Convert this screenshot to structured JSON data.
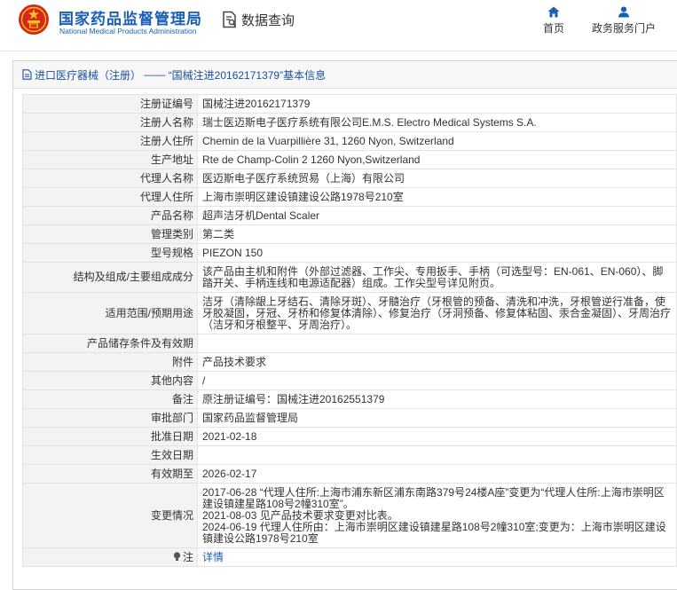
{
  "header": {
    "brand_cn": "国家药品监督管理局",
    "brand_en": "National Medical Products Administration",
    "query_label": "数据查询",
    "nav": [
      {
        "label": "首页",
        "icon": "home-icon"
      },
      {
        "label": "政务服务门户",
        "icon": "user-icon"
      }
    ]
  },
  "panel": {
    "title_prefix": "进口医疗器械（注册）",
    "title_sep": " —— ",
    "title_quote": "“国械注进20162171379”基本信息",
    "icon": "document-icon"
  },
  "rows": [
    {
      "key": "注册证编号",
      "value": "国械注进20162171379"
    },
    {
      "key": "注册人名称",
      "value": "瑞士医迈斯电子医疗系统有限公司E.M.S. Electro Medical Systems S.A."
    },
    {
      "key": "注册人住所",
      "value": "Chemin de la Vuarpillière 31, 1260 Nyon, Switzerland"
    },
    {
      "key": "生产地址",
      "value": "Rte de Champ-Colin 2 1260 Nyon,Switzerland"
    },
    {
      "key": "代理人名称",
      "value": "医迈斯电子医疗系统贸易（上海）有限公司"
    },
    {
      "key": "代理人住所",
      "value": "上海市崇明区建设镇建设公路1978号210室"
    },
    {
      "key": "产品名称",
      "value": "超声洁牙机Dental Scaler"
    },
    {
      "key": "管理类别",
      "value": "第二类"
    },
    {
      "key": "型号规格",
      "value": "PIEZON 150"
    },
    {
      "key": "结构及组成/主要组成成分",
      "value": "该产品由主机和附件（外部过滤器、工作尖、专用扳手、手柄（可选型号：EN-061、EN-060）、脚踏开关、手柄连线和电源适配器）组成。工作尖型号详见附页。"
    },
    {
      "key": "适用范围/预期用途",
      "value": "洁牙（清除龈上牙结石、清除牙斑）、牙髓治疗（牙根管的预备、清洗和冲洗，牙根管逆行准备，使牙胶凝固，牙冠、牙桥和修复体清除）、修复治疗（牙洞预备、修复体粘固、汞合金凝固）、牙周治疗（洁牙和牙根整平、牙周治疗）。"
    },
    {
      "key": "产品储存条件及有效期",
      "value": ""
    },
    {
      "key": "附件",
      "value": "产品技术要求"
    },
    {
      "key": "其他内容",
      "value": "/"
    },
    {
      "key": "备注",
      "value": "原注册证编号：国械注进20162551379"
    },
    {
      "key": "审批部门",
      "value": "国家药品监督管理局"
    },
    {
      "key": "批准日期",
      "value": "2021-02-18"
    },
    {
      "key": "生效日期",
      "value": ""
    },
    {
      "key": "有效期至",
      "value": "2026-02-17"
    },
    {
      "key": "变更情况",
      "value": "2017-06-28 “代理人住所:上海市浦东新区浦东南路379号24楼A座”变更为“代理人住所:上海市崇明区建设镇建星路108号2幢310室”。\n2021-08-03 见产品技术要求变更对比表。\n2024-06-19 代理人住所由：上海市崇明区建设镇建星路108号2幢310室;变更为：上海市崇明区建设镇建设公路1978号210室"
    }
  ],
  "note_row": {
    "key": "注",
    "value": "详情",
    "icon": "info-bulb-icon"
  },
  "colors": {
    "brand_blue": "#1a5fb4",
    "emblem_red": "#d7261e",
    "emblem_gold": "#f5c518",
    "key_bg": "#f3f3f3"
  }
}
